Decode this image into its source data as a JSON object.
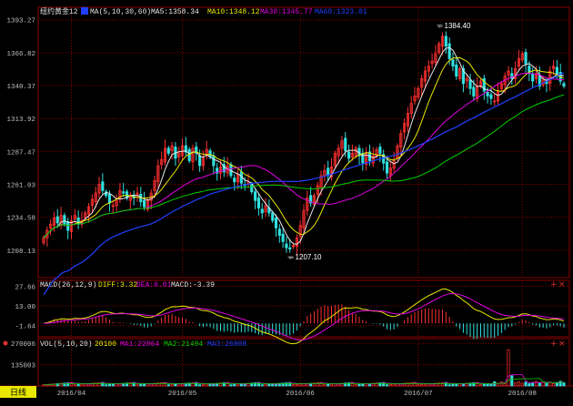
{
  "colors": {
    "background": "#000000",
    "grid": "#8b0000",
    "axis_text": "#c0c0c0",
    "up": "#ff3030",
    "down": "#30e0e0",
    "ma5": "#e8e8e8",
    "ma10": "#e8e800",
    "ma30": "#e000e0",
    "ma60": "#00d000",
    "ma_long": "#2040ff",
    "diff": "#e8e800",
    "dea": "#e000e0",
    "vol_ma1": "#e000e0",
    "vol_ma2": "#00d000",
    "vol_ma3": "#2040ff",
    "label_period_bg": "#e8e800"
  },
  "main_legend": {
    "symbol": "纽约黄金12",
    "ma_label": "MA(5,10,30,60)",
    "ma5": "MA5:1358.34",
    "ma10": "MA10:1348.12",
    "ma30": "MA30:1345.77",
    "ma60": "MA60:1323.01"
  },
  "macd_legend": {
    "params": "MACD(26,12,9)",
    "diff": "DIFF:3.32",
    "dea": "DEA:6.01",
    "macd": "MACD:-3.39"
  },
  "vol_legend": {
    "params": "VOL(5,10,20)",
    "vol": "20100",
    "ma1": "MA1:22864",
    "ma2": "MA2:21494",
    "ma3": "MA3:26808"
  },
  "period_label": "日线",
  "icons": {
    "macd_tools": "plus-close-icons",
    "vol_tools": "plus-close-icons"
  },
  "chart_data": [
    {
      "type": "candlestick",
      "y_ticks": [
        "1393.27",
        "1366.82",
        "1340.37",
        "1313.92",
        "1287.47",
        "1261.03",
        "1234.58",
        "1208.13"
      ],
      "y_tick_values": [
        1393.27,
        1366.82,
        1340.37,
        1313.92,
        1287.47,
        1261.03,
        1234.58,
        1208.13
      ],
      "ylim": [
        1186,
        1396
      ],
      "x_labels": [
        "2016/04",
        "2016/05",
        "2016/06",
        "2016/07",
        "2016/08"
      ],
      "x_label_indices": [
        8,
        40,
        74,
        108,
        138
      ],
      "annotations": [
        {
          "text": "1384.40",
          "index": 115,
          "value": 1384.4,
          "kind": "high"
        },
        {
          "text": "1207.10",
          "index": 72,
          "value": 1207.1,
          "kind": "low"
        }
      ],
      "closes": [
        1218,
        1224,
        1229,
        1234,
        1230,
        1236,
        1229,
        1224,
        1232,
        1236,
        1229,
        1232,
        1238,
        1243,
        1249,
        1254,
        1261,
        1256,
        1252,
        1246,
        1244,
        1248,
        1256,
        1254,
        1250,
        1252,
        1250,
        1254,
        1247,
        1243,
        1248,
        1254,
        1264,
        1276,
        1281,
        1290,
        1286,
        1292,
        1282,
        1286,
        1292,
        1287,
        1280,
        1290,
        1286,
        1276,
        1282,
        1289,
        1283,
        1276,
        1270,
        1275,
        1271,
        1276,
        1268,
        1263,
        1269,
        1262,
        1260,
        1263,
        1255,
        1248,
        1242,
        1238,
        1244,
        1238,
        1232,
        1226,
        1220,
        1215,
        1210,
        1209,
        1212,
        1218,
        1228,
        1240,
        1250,
        1246,
        1252,
        1260,
        1268,
        1272,
        1268,
        1275,
        1286,
        1290,
        1296,
        1288,
        1282,
        1286,
        1290,
        1284,
        1278,
        1286,
        1280,
        1284,
        1289,
        1286,
        1278,
        1270,
        1274,
        1280,
        1292,
        1302,
        1310,
        1318,
        1326,
        1332,
        1338,
        1346,
        1352,
        1356,
        1360,
        1366,
        1374,
        1380,
        1372,
        1362,
        1356,
        1348,
        1354,
        1342,
        1346,
        1338,
        1332,
        1340,
        1344,
        1336,
        1332,
        1330,
        1328,
        1336,
        1342,
        1348,
        1352,
        1346,
        1354,
        1362,
        1366,
        1358,
        1350,
        1344,
        1350,
        1340,
        1346,
        1342,
        1352,
        1356,
        1350,
        1344,
        1340
      ],
      "ma_values": {
        "ma5": 1358.34,
        "ma10": 1348.12,
        "ma30": 1345.77,
        "ma60": 1323.01
      }
    },
    {
      "type": "bar",
      "name": "MACD",
      "y_ticks": [
        "27.66",
        "13.00",
        "-1.64"
      ],
      "y_tick_values": [
        27.66,
        13.0,
        -1.64
      ],
      "ylim": [
        -10,
        32
      ],
      "diff": 3.32,
      "dea": 6.01,
      "macd": -3.39
    },
    {
      "type": "bar",
      "name": "VOL",
      "y_ticks": [
        "270006",
        "135003"
      ],
      "y_tick_values": [
        270006,
        135003
      ],
      "ylim": [
        0,
        300000
      ],
      "volume": 20100,
      "ma1": 22864,
      "ma2": 21494,
      "ma3": 26808
    }
  ]
}
